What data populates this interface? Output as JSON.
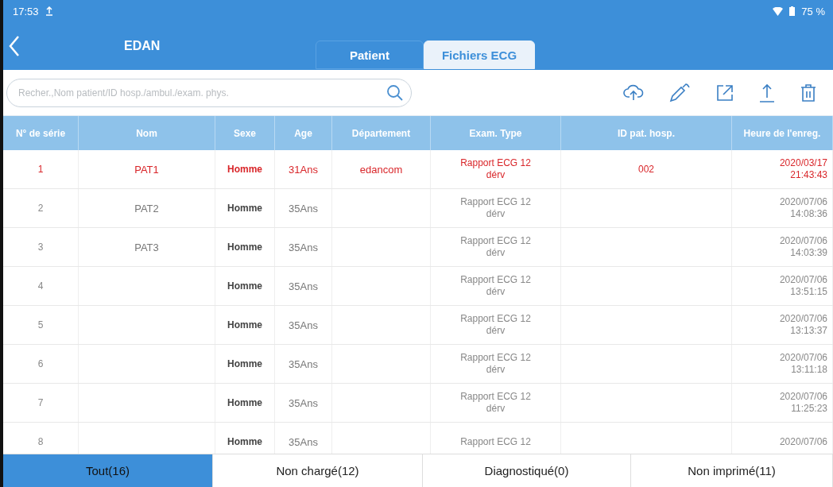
{
  "status_bar": {
    "time": "17:53",
    "battery": "75 %"
  },
  "nav": {
    "title": "EDAN",
    "tabs": [
      {
        "label": "Patient",
        "selected": false
      },
      {
        "label": "Fichiers ECG",
        "selected": true
      }
    ]
  },
  "search": {
    "placeholder": "Recher.,Nom patient/ID hosp./ambul./exam. phys."
  },
  "table": {
    "columns": [
      "N° de série",
      "Nom",
      "Sexe",
      "Age",
      "Département",
      "Exam. Type",
      "ID pat. hosp.",
      "Heure de l'enreg."
    ],
    "rows": [
      {
        "selected": true,
        "cells": [
          "1",
          "PAT1",
          "Homme",
          "31Ans",
          "edancom",
          "Rapport ECG 12\ndérv",
          "002",
          "2020/03/17\n21:43:43"
        ]
      },
      {
        "selected": false,
        "cells": [
          "2",
          "PAT2",
          "Homme",
          "35Ans",
          "",
          "Rapport ECG 12\ndérv",
          "",
          "2020/07/06\n14:08:36"
        ]
      },
      {
        "selected": false,
        "cells": [
          "3",
          "PAT3",
          "Homme",
          "35Ans",
          "",
          "Rapport ECG 12\ndérv",
          "",
          "2020/07/06\n14:03:39"
        ]
      },
      {
        "selected": false,
        "cells": [
          "4",
          "",
          "Homme",
          "35Ans",
          "",
          "Rapport ECG 12\ndérv",
          "",
          "2020/07/06\n13:51:15"
        ]
      },
      {
        "selected": false,
        "cells": [
          "5",
          "",
          "Homme",
          "35Ans",
          "",
          "Rapport ECG 12\ndérv",
          "",
          "2020/07/06\n13:13:37"
        ]
      },
      {
        "selected": false,
        "cells": [
          "6",
          "",
          "Homme",
          "35Ans",
          "",
          "Rapport ECG 12\ndérv",
          "",
          "2020/07/06\n13:11:18"
        ]
      },
      {
        "selected": false,
        "cells": [
          "7",
          "",
          "Homme",
          "35Ans",
          "",
          "Rapport ECG 12\ndérv",
          "",
          "2020/07/06\n11:25:23"
        ]
      },
      {
        "selected": false,
        "cells": [
          "8",
          "",
          "Homme",
          "35Ans",
          "",
          "Rapport ECG 12",
          "",
          "2020/07/06"
        ]
      }
    ]
  },
  "filter_tabs": [
    {
      "label": "Tout(16)",
      "selected": true
    },
    {
      "label": "Non chargé(12)",
      "selected": false
    },
    {
      "label": "Diagnostiqué(0)",
      "selected": false
    },
    {
      "label": "Non imprimé(11)",
      "selected": false
    }
  ]
}
